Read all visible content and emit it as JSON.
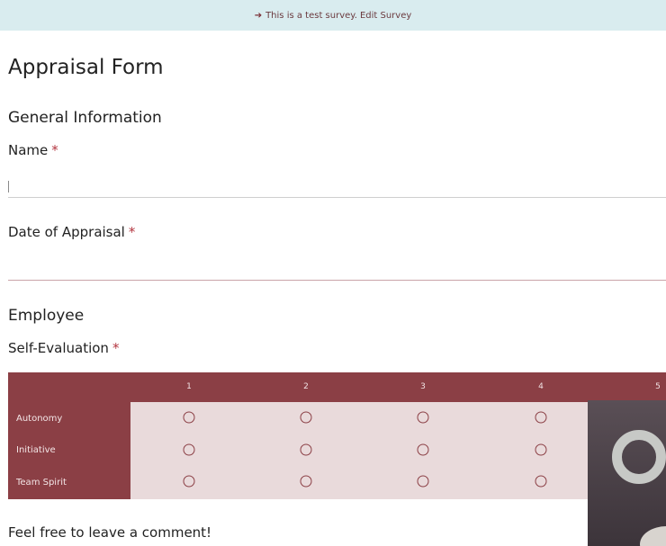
{
  "banner": {
    "text": "This is a test survey.",
    "edit_link": "Edit Survey"
  },
  "form": {
    "title": "Appraisal Form",
    "section_general": "General Information",
    "name_label": "Name",
    "date_label": "Date of Appraisal",
    "section_employee": "Employee",
    "self_eval_label": "Self-Evaluation",
    "required_mark": "*",
    "comment_label": "Feel free to leave a comment!"
  },
  "matrix": {
    "columns": [
      "1",
      "2",
      "3",
      "4",
      "5"
    ],
    "rows": [
      "Autonomy",
      "Initiative",
      "Team Spirit"
    ]
  },
  "colors": {
    "banner_bg": "#d9ecef",
    "accent": "#8b3f45",
    "matrix_bg": "#e9dadb",
    "required": "#b3353f"
  }
}
